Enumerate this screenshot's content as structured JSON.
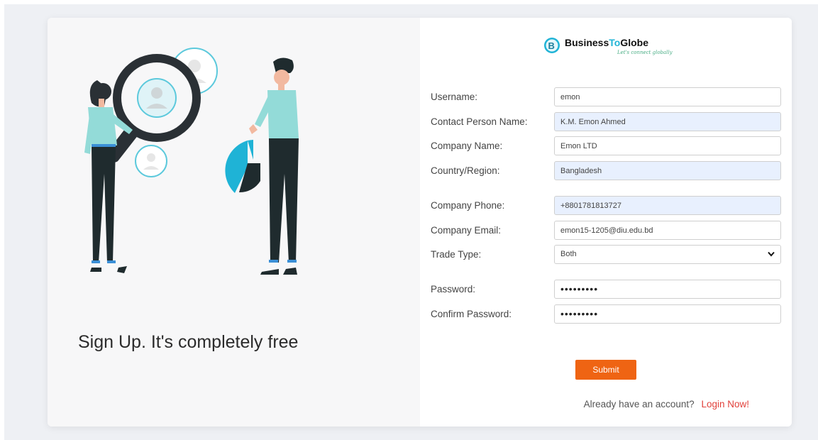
{
  "left": {
    "tagline": "Sign Up. It's completely free"
  },
  "logo": {
    "word_business": "Business",
    "word_to": "To",
    "word_globe": "Globe",
    "tagline": "Let's connect globally"
  },
  "form": {
    "fields": [
      {
        "label": "Username:",
        "value": "emon",
        "autofilled": false
      },
      {
        "label": "Contact Person Name:",
        "value": "K.M. Emon Ahmed",
        "autofilled": true
      },
      {
        "label": "Company Name:",
        "value": "Emon LTD",
        "autofilled": false
      },
      {
        "label": "Country/Region:",
        "value": "Bangladesh",
        "autofilled": true
      },
      {
        "label": "Company Phone:",
        "value": "+8801781813727",
        "autofilled": true
      },
      {
        "label": "Company Email:",
        "value": "emon15-1205@diu.edu.bd",
        "autofilled": false
      },
      {
        "label": "Trade Type:",
        "value": "Both",
        "autofilled": false
      },
      {
        "label": "Password:",
        "value": "•••••••••",
        "autofilled": false
      },
      {
        "label": "Confirm Password:",
        "value": "•••••••••",
        "autofilled": false
      }
    ],
    "submit_label": "Submit",
    "login_prompt": "Already have an account?",
    "login_link": "Login Now!"
  },
  "colors": {
    "accent": "#ef6413",
    "link": "#e1403a",
    "brand_teal": "#1fb3d6",
    "autofill_bg": "#e8f0fe"
  },
  "icons": [
    "logo-mark-icon",
    "chevron-down-icon"
  ]
}
